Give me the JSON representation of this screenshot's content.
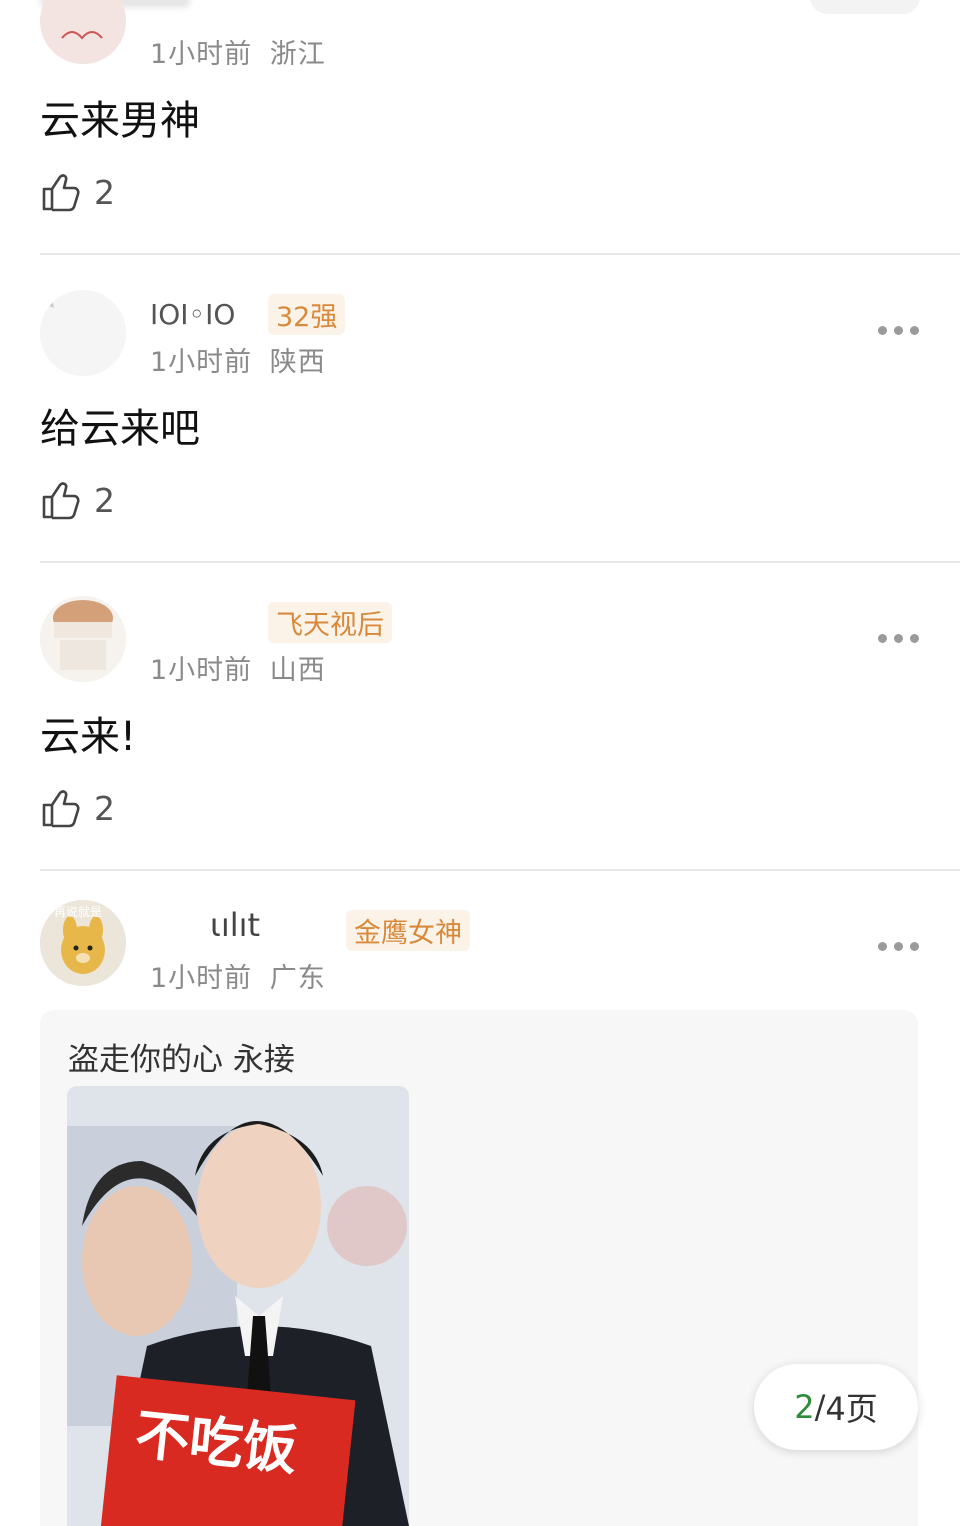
{
  "comments": [
    {
      "time": "1小时前",
      "location": "浙江",
      "text": "云来男神",
      "likes": "2"
    },
    {
      "username": "IOI◦IO",
      "badge": "32强",
      "time": "1小时前",
      "location": "陕西",
      "text": "给云来吧",
      "likes": "2"
    },
    {
      "badge": "飞天视后",
      "time": "1小时前",
      "location": "山西",
      "text": "云来!",
      "likes": "2"
    },
    {
      "username": "ιılıt",
      "badge": "金鹰女神",
      "avatar_text": "再说就是",
      "time": "1小时前",
      "location": "广东",
      "attachment": {
        "title": "盗走你的心 永接",
        "sign_text": "不吃饭"
      }
    }
  ],
  "pager": {
    "current": "2",
    "sep": "/",
    "total": "4页"
  },
  "colors": {
    "badge": "#d88a3c",
    "pager_current": "#2e8b3a",
    "divider": "#e6e6e6"
  },
  "icons": [
    "thumbs-up-icon",
    "more-icon"
  ]
}
